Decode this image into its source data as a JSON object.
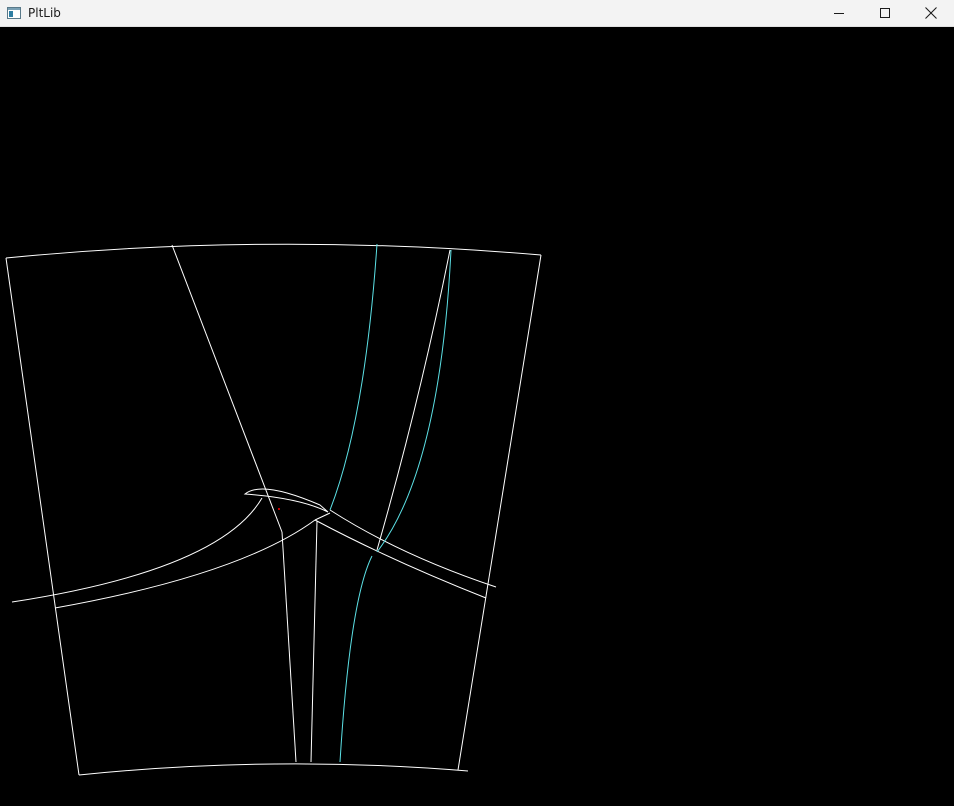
{
  "window": {
    "title": "PltLib",
    "icon": "app-window-icon",
    "controls": {
      "minimize_icon": "minimize-icon",
      "maximize_icon": "maximize-icon",
      "close_icon": "close-icon"
    }
  },
  "canvas": {
    "background_color": "#000000",
    "line_color": "#ffffff",
    "accent_line_color": "#5ce1e6",
    "marker_color": "#ff0000"
  }
}
